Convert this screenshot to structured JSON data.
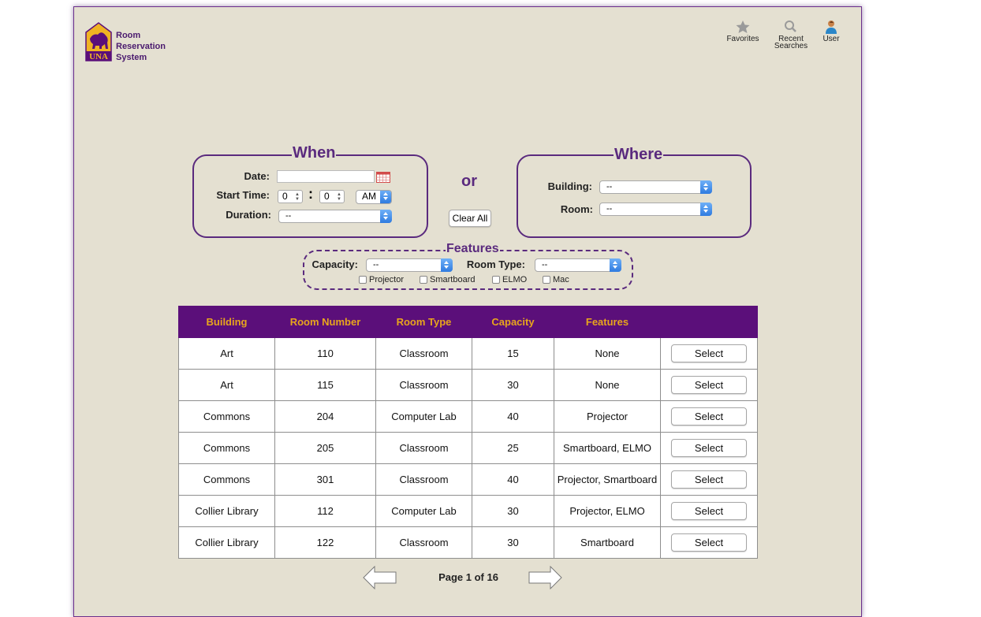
{
  "app": {
    "logo_mark": "UNA",
    "title_lines": [
      "Room",
      "Reservation",
      "System"
    ]
  },
  "nav": {
    "favorites": {
      "label": "Favorites",
      "icon": "star-icon"
    },
    "recent": {
      "label_line1": "Recent",
      "label_line2": "Searches",
      "icon": "magnifier-icon"
    },
    "user": {
      "label": "User",
      "icon": "user-icon"
    }
  },
  "when": {
    "legend": "When",
    "date_label": "Date:",
    "date_value": "",
    "start_time_label": "Start Time:",
    "hour": "0",
    "minute": "0",
    "time_sep": ":",
    "ampm": "AM",
    "duration_label": "Duration:",
    "duration_value": "--"
  },
  "or_label": "or",
  "clear_all_label": "Clear All",
  "where": {
    "legend": "Where",
    "building_label": "Building:",
    "building_value": "--",
    "room_label": "Room:",
    "room_value": "--"
  },
  "features": {
    "legend": "Features",
    "capacity_label": "Capacity:",
    "capacity_value": "--",
    "room_type_label": "Room Type:",
    "room_type_value": "--",
    "checkboxes": [
      "Projector",
      "Smartboard",
      "ELMO",
      "Mac"
    ]
  },
  "table": {
    "headers": [
      "Building",
      "Room Number",
      "Room Type",
      "Capacity",
      "Features",
      ""
    ],
    "select_label": "Select",
    "rows": [
      [
        "Art",
        "110",
        "Classroom",
        "15",
        "None"
      ],
      [
        "Art",
        "115",
        "Classroom",
        "30",
        "None"
      ],
      [
        "Commons",
        "204",
        "Computer Lab",
        "40",
        "Projector"
      ],
      [
        "Commons",
        "205",
        "Classroom",
        "25",
        "Smartboard, ELMO"
      ],
      [
        "Commons",
        "301",
        "Classroom",
        "40",
        "Projector, Smartboard"
      ],
      [
        "Collier Library",
        "112",
        "Computer Lab",
        "30",
        "Projector, ELMO"
      ],
      [
        "Collier Library",
        "122",
        "Classroom",
        "30",
        "Smartboard"
      ]
    ]
  },
  "pager": {
    "text": "Page 1 of 16"
  },
  "colors": {
    "background": "#e4e0d1",
    "brand_purple": "#5b0f7a",
    "brand_gold": "#e8a61c"
  }
}
